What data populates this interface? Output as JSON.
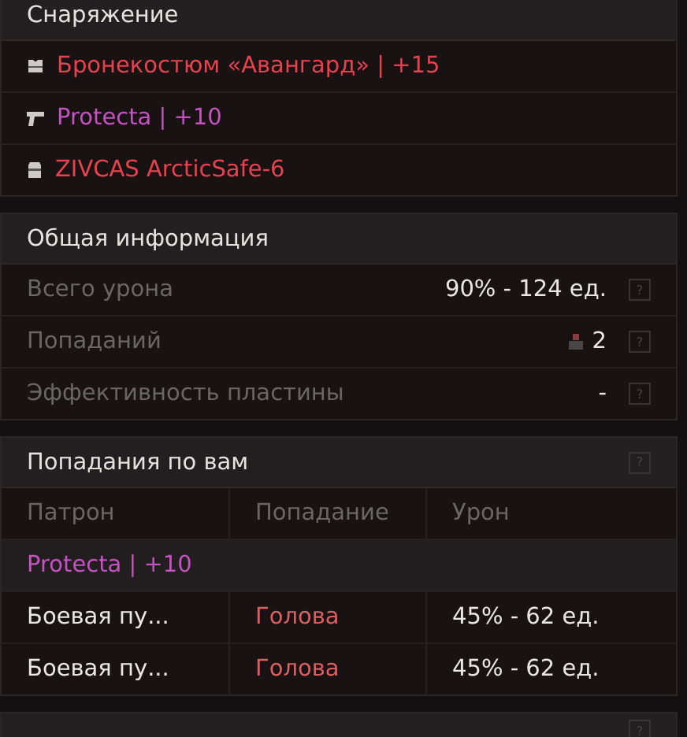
{
  "equipment": {
    "title": "Снаряжение",
    "items": [
      {
        "kind": "armor",
        "name": "Бронекостюм «Авангард» | +15",
        "color": "#e8424f"
      },
      {
        "kind": "weapon",
        "name": "Protecta | +10",
        "color": "#c452c0"
      },
      {
        "kind": "helmet",
        "name": "ZIVCAS ArcticSafe-6",
        "color": "#e8424f"
      }
    ]
  },
  "general": {
    "title": "Общая информация",
    "rows": [
      {
        "label": "Всего урона",
        "value": "90% - 124 ед.",
        "help": "?"
      },
      {
        "label": "Попаданий",
        "value": "2",
        "hits_icon": true,
        "help": "?"
      },
      {
        "label": "Эффективность пластины",
        "value": "-",
        "help": "?"
      }
    ]
  },
  "hits_on_you": {
    "title": "Попадания по вам",
    "help": "?",
    "columns": [
      "Патрон",
      "Попадание",
      "Урон"
    ],
    "groups": [
      {
        "weapon": "Protecta | +10",
        "color": "#c452c0",
        "rows": [
          {
            "cells": [
              "Боевая пу...",
              "Голова",
              "45% - 62 ед."
            ]
          },
          {
            "cells": [
              "Боевая пу...",
              "Голова",
              "45% - 62 ед."
            ]
          }
        ]
      }
    ]
  },
  "next_section": {
    "help": "?"
  }
}
